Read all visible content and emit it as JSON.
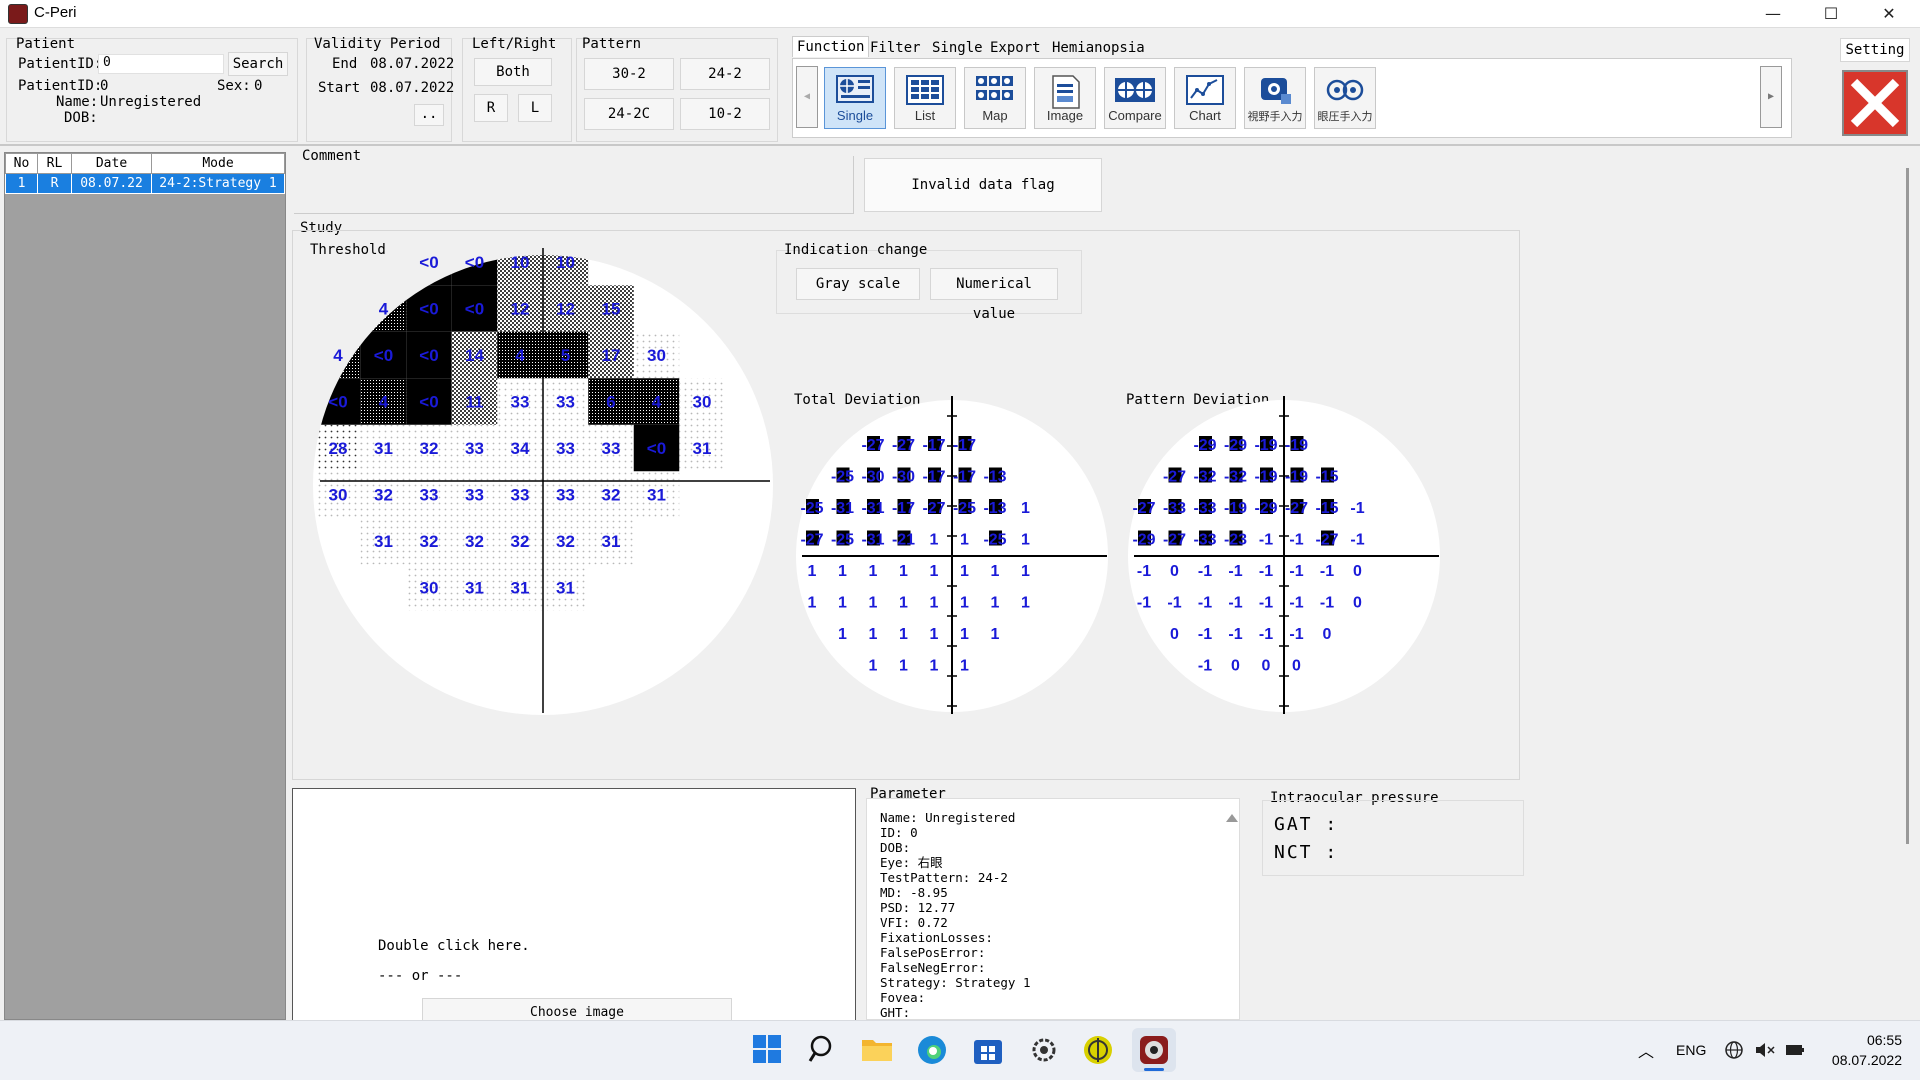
{
  "window": {
    "title": "C-Peri",
    "minimize": "—",
    "maximize": "☐",
    "close": "✕"
  },
  "patient": {
    "group_label": "Patient",
    "id_label": "PatientID:",
    "id_input_value": "0",
    "search_label": "Search",
    "id_label2": "PatientID:",
    "id_value2": "0",
    "sex_label": "Sex:",
    "sex_value": "0",
    "name_label": "Name:",
    "name_value": "Unregistered",
    "dob_label": "DOB:",
    "dob_value": ""
  },
  "validity": {
    "group_label": "Validity Period",
    "end_label": "End",
    "end_value": "08.07.2022",
    "start_label": "Start",
    "start_value": "08.07.2022",
    "more_label": ".."
  },
  "leftright": {
    "group_label": "Left/Right",
    "both": "Both",
    "r": "R",
    "l": "L"
  },
  "pattern": {
    "group_label": "Pattern",
    "options": [
      "30-2",
      "24-2",
      "24-2C",
      "10-2"
    ]
  },
  "tabs": [
    "Function",
    "Filter",
    "Single",
    "Export",
    "Hemianopsia"
  ],
  "setting_label": "Setting",
  "toolbar": {
    "left_arrow": "◀",
    "right_arrow": "▶",
    "buttons": [
      {
        "label": "Single",
        "icon": "single-icon"
      },
      {
        "label": "List",
        "icon": "list-icon"
      },
      {
        "label": "Map",
        "icon": "map-icon"
      },
      {
        "label": "Image",
        "icon": "image-icon"
      },
      {
        "label": "Compare",
        "icon": "compare-icon"
      },
      {
        "label": "Chart",
        "icon": "chart-icon"
      },
      {
        "label": "視野手入力",
        "icon": "visual-field-input-icon"
      },
      {
        "label": "眼圧手入力",
        "icon": "iop-input-icon"
      }
    ]
  },
  "study_list": {
    "headers": [
      "No",
      "RL",
      "Date",
      "Mode"
    ],
    "rows": [
      {
        "no": "1",
        "rl": "R",
        "date": "08.07.22",
        "mode": "24-2:Strategy 1"
      }
    ]
  },
  "comment_label": "Comment",
  "invalid_flag_label": "Invalid data flag",
  "study_label": "Study",
  "threshold_label": "Threshold",
  "indication": {
    "label": "Indication change",
    "gray": "Gray scale",
    "numerical": "Numerical value"
  },
  "total_dev_label": "Total Deviation",
  "pattern_dev_label": "Pattern Deviation",
  "threshold_rows": [
    [
      "<0",
      "<0",
      "10",
      "10"
    ],
    [
      "4",
      "<0",
      "<0",
      "12",
      "12",
      "15"
    ],
    [
      "4",
      "<0",
      "<0",
      "14",
      "4",
      "5",
      "17",
      "30"
    ],
    [
      "<0",
      "4",
      "<0",
      "11",
      "33",
      "33",
      "6",
      "4",
      "30"
    ],
    [
      "28",
      "31",
      "32",
      "33",
      "34",
      "33",
      "33",
      "<0",
      "31"
    ],
    [
      "30",
      "32",
      "33",
      "33",
      "33",
      "33",
      "32",
      "31"
    ],
    [
      "31",
      "32",
      "32",
      "32",
      "32",
      "31"
    ],
    [
      "30",
      "31",
      "31",
      "31"
    ]
  ],
  "total_dev_rows": [
    [
      "-27",
      "-27",
      "-17",
      "-17"
    ],
    [
      "-25",
      "-30",
      "-30",
      "-17",
      "-17",
      "-13"
    ],
    [
      "-25",
      "-31",
      "-31",
      "-17",
      "-27",
      "-25",
      "-13",
      "1"
    ],
    [
      "-27",
      "-25",
      "-31",
      "-21",
      "1",
      "1",
      "-25",
      "1"
    ],
    [
      "1",
      "1",
      "1",
      "1",
      "1",
      "1",
      "1",
      "1"
    ],
    [
      "1",
      "1",
      "1",
      "1",
      "1",
      "1",
      "1",
      "1"
    ],
    [
      "1",
      "1",
      "1",
      "1",
      "1",
      "1"
    ],
    [
      "1",
      "1",
      "1",
      "1"
    ]
  ],
  "pattern_dev_rows": [
    [
      "-29",
      "-29",
      "-19",
      "-19"
    ],
    [
      "-27",
      "-32",
      "-32",
      "-19",
      "-19",
      "-15"
    ],
    [
      "-27",
      "-33",
      "-33",
      "-19",
      "-29",
      "-27",
      "-15",
      "-1"
    ],
    [
      "-29",
      "-27",
      "-33",
      "-23",
      "-1",
      "-1",
      "-27",
      "-1"
    ],
    [
      "-1",
      "0",
      "-1",
      "-1",
      "-1",
      "-1",
      "-1",
      "0"
    ],
    [
      "-1",
      "-1",
      "-1",
      "-1",
      "-1",
      "-1",
      "-1",
      "0"
    ],
    [
      "0",
      "-1",
      "-1",
      "-1",
      "-1",
      "0"
    ],
    [
      "-1",
      "0",
      "0",
      "0"
    ]
  ],
  "image_panel": {
    "double_click": "Double click here.",
    "or": "--- or ---",
    "choose": "Choose image"
  },
  "parameter": {
    "label": "Parameter",
    "lines": [
      "Name: Unregistered",
      "ID: 0",
      "DOB:",
      "Eye: 右眼",
      "TestPattern: 24-2",
      "MD: -8.95",
      "PSD: 12.77",
      "VFI: 0.72",
      "FixationLosses:",
      "FalsePosError:",
      "FalseNegError:",
      "Strategy: Strategy 1",
      "Fovea:",
      "GHT:"
    ]
  },
  "iop": {
    "label": "Intraocular pressure",
    "gat": "GAT :",
    "nct": "NCT :"
  },
  "taskbar": {
    "lang": "ENG",
    "time": "06:55",
    "date": "08.07.2022"
  }
}
